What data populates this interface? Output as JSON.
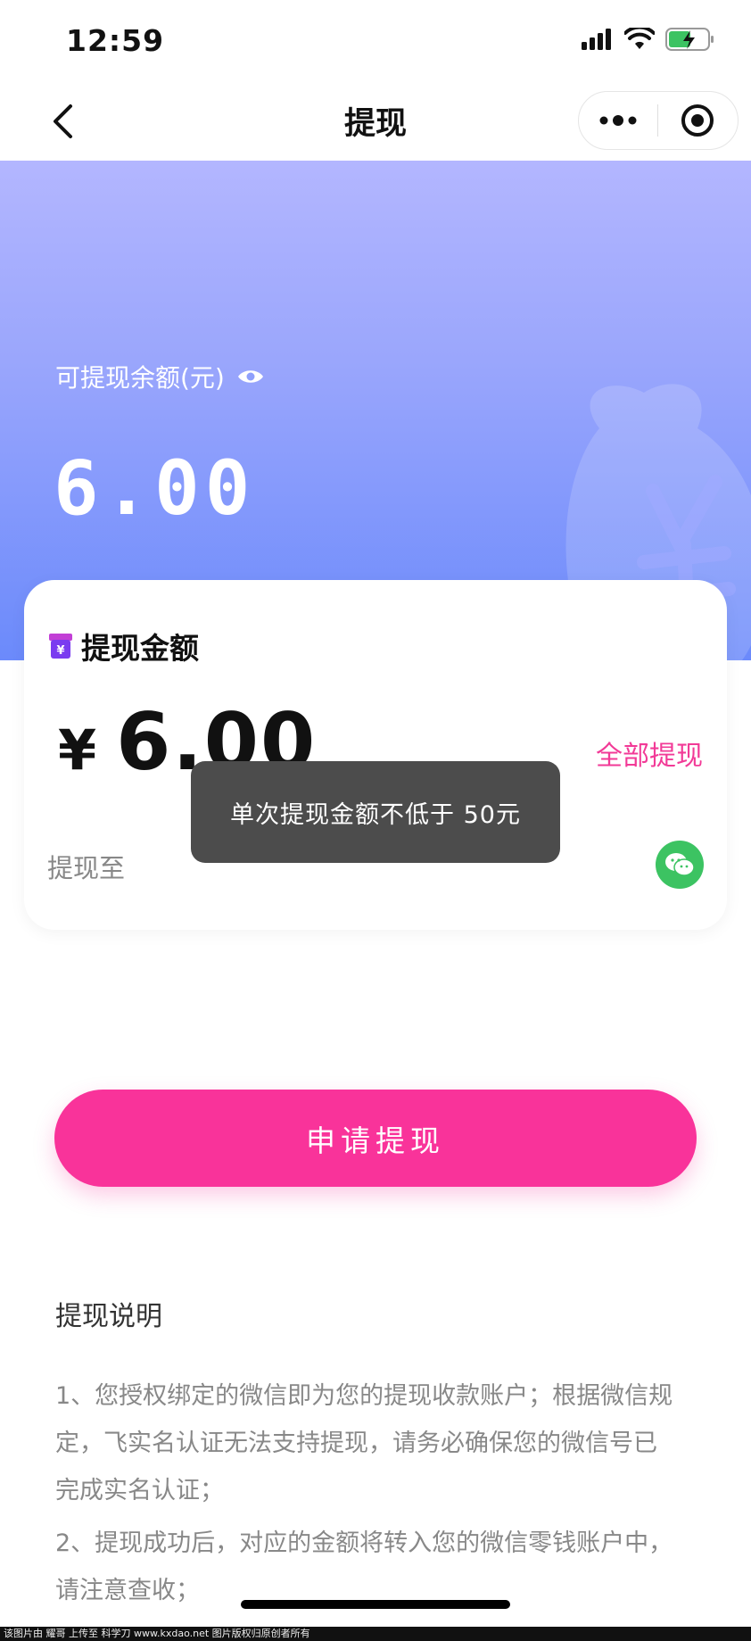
{
  "status_bar": {
    "time": "12:59"
  },
  "nav": {
    "title": "提现"
  },
  "hero": {
    "balance_label": "可提现余额(元)",
    "balance_value": "6.00"
  },
  "card": {
    "title": "提现金额",
    "currency": "¥",
    "amount": "6.00",
    "withdraw_all": "全部提现",
    "to_label": "提现至"
  },
  "toast": {
    "message": "单次提现金额不低于 50元"
  },
  "apply_button": {
    "label": "申请提现"
  },
  "instructions": {
    "title": "提现说明",
    "items": [
      "1、您授权绑定的微信即为您的提现收款账户；根据微信规定，飞实名认证无法支持提现，请务必确保您的微信号已完成实名认证；",
      "2、提现成功后，对应的金额将转入您的微信零钱账户中，请注意查收；"
    ]
  },
  "watermark": {
    "text": "该图片由 耀哥 上传至 科学刀 www.kxdao.net 图片版权归原创者所有"
  },
  "colors": {
    "accent_pink": "#f9339a",
    "link_pink": "#f23a97",
    "wechat_green": "#3cc362"
  }
}
